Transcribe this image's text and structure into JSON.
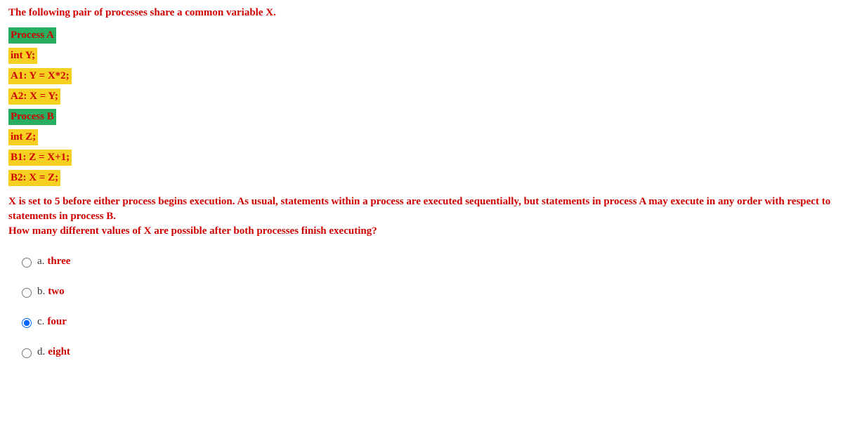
{
  "intro": "The following pair of processes share a common variable X.",
  "lines": {
    "procA": "Process A",
    "intY": "int Y;",
    "a1": "A1: Y = X*2;",
    "a2": "A2: X = Y;",
    "procB": "Process B",
    "intZ": "int Z;",
    "b1": "B1: Z = X+1;",
    "b2": "B2: X = Z;"
  },
  "qtext1": "X is set to 5 before either process begins execution. As usual, statements within a process are executed sequentially, but statements in process A may execute in any order with respect to statements in process B.",
  "qtext2": "How many different values of X are possible after both processes finish executing?",
  "options": {
    "a": {
      "letter": "a.",
      "text": "three"
    },
    "b": {
      "letter": "b.",
      "text": "two"
    },
    "c": {
      "letter": "c.",
      "text": "four"
    },
    "d": {
      "letter": "d.",
      "text": "eight"
    }
  }
}
